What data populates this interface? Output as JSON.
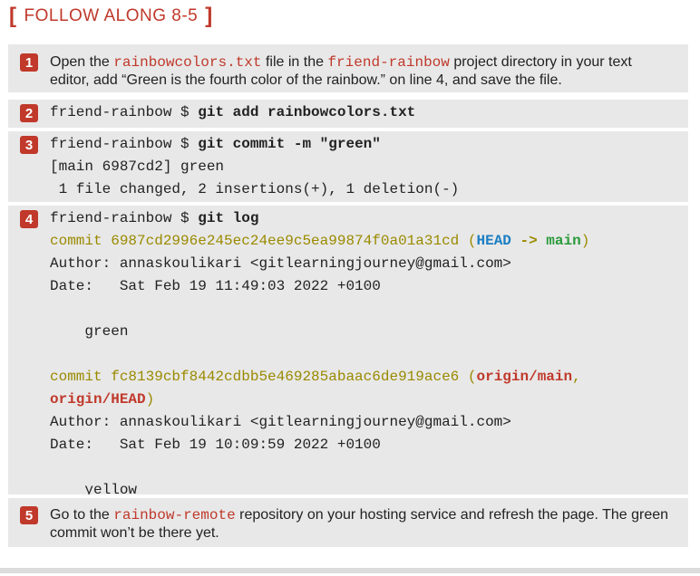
{
  "header": {
    "open_bracket": "[",
    "label": "FOLLOW ALONG 8-5",
    "close_bracket": "]"
  },
  "steps": [
    {
      "number": "1",
      "parts": [
        "Open the ",
        "rainbowcolors.txt",
        " file in the ",
        "friend-rainbow",
        " project directory in your text editor, add “Green is the fourth color of the rainbow.” on line 4, and save the file."
      ]
    },
    {
      "number": "2",
      "prompt": "friend-rainbow $ ",
      "command": "git add rainbowcolors.txt"
    },
    {
      "number": "3",
      "prompt": "friend-rainbow $ ",
      "command": "git commit -m \"green\"",
      "output": [
        "[main 6987cd2] green",
        " 1 file changed, 2 insertions(+), 1 deletion(-)"
      ]
    },
    {
      "number": "4",
      "prompt": "friend-rainbow $ ",
      "command": "git log",
      "commit1": {
        "hash_line": "commit 6987cd2996e245ec24ee9c5ea99874f0a01a31cd ",
        "open_paren": "(",
        "head": "HEAD",
        "arrow": " -> ",
        "branch": "main",
        "close_paren": ")",
        "author": "Author: annaskoulikari <gitlearningjourney@gmail.com>",
        "date": "Date:   Sat Feb 19 11:49:03 2022 +0100",
        "message": "    green"
      },
      "commit2": {
        "hash_line": "commit fc8139cbf8442cdbb5e469285abaac6de919ace6 ",
        "open_paren": "(",
        "ref1": "origin/main",
        "comma": ",",
        "ref2": "origin/HEAD",
        "close_paren": ")",
        "author": "Author: annaskoulikari <gitlearningjourney@gmail.com>",
        "date": "Date:   Sat Feb 19 10:09:59 2022 +0100",
        "message": "    yellow"
      }
    },
    {
      "number": "5",
      "parts": [
        "Go to the ",
        "rainbow-remote",
        " repository on your hosting service and refresh the page. The green commit won’t be there yet."
      ]
    }
  ],
  "colors": {
    "accent_red": "#c0392b",
    "panel_gray": "#e8e8e8",
    "commit_olive": "#9a8a00",
    "head_blue": "#1c7ec4",
    "branch_green": "#2a9a3a"
  }
}
